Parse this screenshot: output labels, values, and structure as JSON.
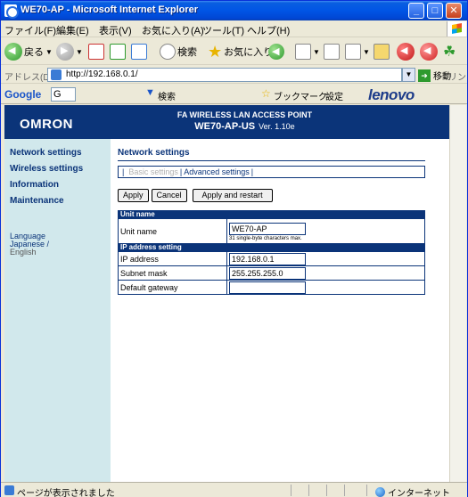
{
  "window": {
    "title": "WE70-AP - Microsoft Internet Explorer"
  },
  "menubar": {
    "items": [
      "ファイル(F)",
      "編集(E)",
      "表示(V)",
      "お気に入り(A)",
      "ツール(T)",
      "ヘルプ(H)"
    ]
  },
  "toolbar": {
    "back_label": "戻る",
    "search_label": "検索",
    "favorites_label": "お気に入り"
  },
  "addressbar": {
    "label": "アドレス(D)",
    "url": "http://192.168.0.1/",
    "go_label": "移動",
    "links_label": "リンク"
  },
  "googlebar": {
    "logo": "Google",
    "search_value": "G",
    "search_label": "検索",
    "bookmarks_label": "ブックマーク",
    "settings_label": "設定",
    "brand": "lenovo"
  },
  "page": {
    "brand": "OMRON",
    "product": "FA WIRELESS LAN ACCESS POINT",
    "model": "WE70-AP-US",
    "version": "Ver. 1.10e"
  },
  "leftnav": {
    "items": [
      "Network settings",
      "Wireless settings",
      "Information",
      "Maintenance"
    ],
    "language_label": "Language",
    "language_japanese": "Japanese /",
    "language_english": "English"
  },
  "main": {
    "heading": "Network settings",
    "tabs": {
      "basic": "Basic settings",
      "advanced": "Advanced settings"
    },
    "buttons": {
      "apply": "Apply",
      "cancel": "Cancel",
      "apply_restart": "Apply and restart"
    },
    "sections": {
      "unit": "Unit name",
      "ip": "IP address setting"
    },
    "fields": {
      "unit_name_label": "Unit name",
      "unit_name_value": "WE70-AP",
      "unit_name_hint": "31 single-byte characters max.",
      "ip_label": "IP address",
      "ip_value": "192.168.0.1",
      "mask_label": "Subnet mask",
      "mask_value": "255.255.255.0",
      "gateway_label": "Default gateway",
      "gateway_value": ""
    }
  },
  "statusbar": {
    "text": "ページが表示されました",
    "zone": "インターネット"
  },
  "colors": {
    "titlebar": "#0055e5",
    "header_navy": "#0b3479",
    "nav_bg": "#d1e8ec"
  }
}
